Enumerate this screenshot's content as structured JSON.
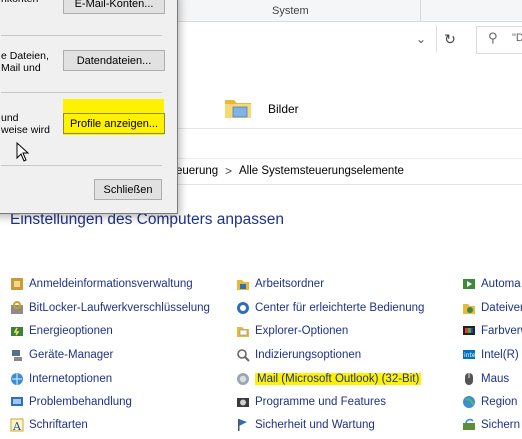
{
  "explorer": {
    "ribbon_group": "System",
    "search_placeholder": "\"D",
    "folder_label": "Bilder",
    "refresh_icon": "refresh-icon",
    "search_icon": "search-icon"
  },
  "control_panel": {
    "nav_fragment": "e",
    "breadcrumb": [
      "euerung",
      "Alle Systemsteuerungselemente"
    ],
    "breadcrumb_separator": ">",
    "heading": "Einstellungen des Computers anpassen",
    "columns": [
      [
        {
          "label": "Anmeldeinformationsverwaltung",
          "icon": "credential-manager-icon"
        },
        {
          "label": "BitLocker-Laufwerkverschlüsselung",
          "icon": "bitlocker-icon"
        },
        {
          "label": "Energieoptionen",
          "icon": "power-options-icon"
        },
        {
          "label": "Geräte-Manager",
          "icon": "device-manager-icon"
        },
        {
          "label": "Internetoptionen",
          "icon": "internet-options-icon"
        },
        {
          "label": "Problembehandlung",
          "icon": "troubleshooting-icon"
        },
        {
          "label": "Schriftarten",
          "icon": "fonts-icon"
        }
      ],
      [
        {
          "label": "Arbeitsordner",
          "icon": "work-folders-icon"
        },
        {
          "label": "Center für erleichterte Bedienung",
          "icon": "ease-of-access-icon"
        },
        {
          "label": "Explorer-Optionen",
          "icon": "explorer-options-icon"
        },
        {
          "label": "Indizierungsoptionen",
          "icon": "indexing-options-icon"
        },
        {
          "label": "Mail (Microsoft Outlook) (32-Bit)",
          "icon": "mail-icon",
          "highlighted": true
        },
        {
          "label": "Programme und Features",
          "icon": "programs-features-icon"
        },
        {
          "label": "Sicherheit und Wartung",
          "icon": "security-maintenance-icon"
        }
      ],
      [
        {
          "label": "Automa",
          "icon": "autoplay-icon"
        },
        {
          "label": "Dateiver",
          "icon": "file-history-icon"
        },
        {
          "label": "Farbverw",
          "icon": "color-management-icon"
        },
        {
          "label": "Intel(R) G",
          "icon": "intel-graphics-icon"
        },
        {
          "label": "Maus",
          "icon": "mouse-icon"
        },
        {
          "label": "Region",
          "icon": "region-icon"
        },
        {
          "label": "Sichern u",
          "icon": "backup-icon"
        }
      ]
    ],
    "highlight_color": "#fff200",
    "link_color": "#1e3287"
  },
  "mail_dialog": {
    "email_accounts_button": "E-Mail-Konten...",
    "email_accounts_text": [
      "nkonten"
    ],
    "data_files_text": [
      "e Dateien,",
      "Mail und"
    ],
    "data_files_button": "Datendateien...",
    "profiles_text": [
      "und",
      "weise wird"
    ],
    "profiles_button": "Profile anzeigen...",
    "close_button": "Schließen"
  }
}
